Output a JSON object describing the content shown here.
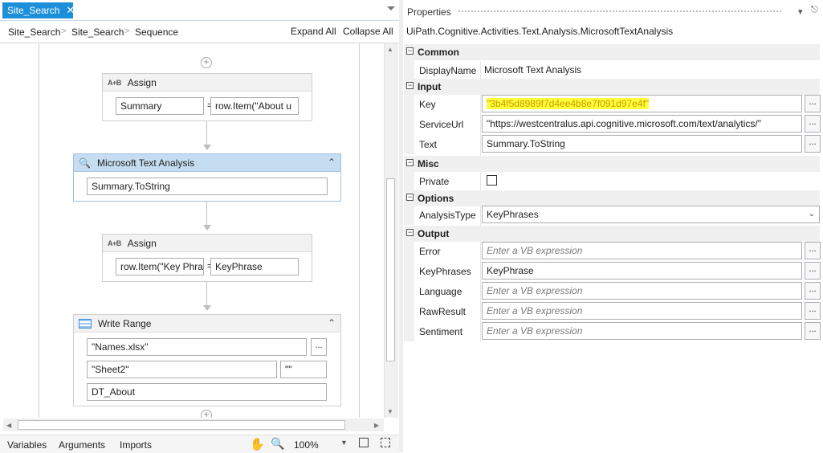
{
  "designer": {
    "tab_title": "Site_Search",
    "tab_close": "✕",
    "breadcrumb": [
      "Site_Search",
      "Site_Search",
      "Sequence"
    ],
    "expand_all": "Expand All",
    "collapse_all": "Collapse All",
    "activities": {
      "assign1": {
        "title": "Assign",
        "icon": "A+B",
        "to": "Summary",
        "value": "row.Item(\"About u"
      },
      "mta": {
        "title": "Microsoft Text Analysis",
        "text": "Summary.ToString"
      },
      "assign2": {
        "title": "Assign",
        "icon": "A+B",
        "to": "row.Item(\"Key Phra",
        "value": "KeyPhrase"
      },
      "write_range": {
        "title": "Write Range",
        "workbook": "\"Names.xlsx\"",
        "sheet": "\"Sheet2\"",
        "start_cell": "\"\"",
        "datatable": "DT_About"
      }
    },
    "bottom_tabs": [
      "Variables",
      "Arguments",
      "Imports"
    ],
    "zoom": "100%"
  },
  "properties": {
    "title": "Properties",
    "type_name": "UiPath.Cognitive.Activities.Text.Analysis.MicrosoftTextAnalysis",
    "categories": {
      "common": "Common",
      "input": "Input",
      "misc": "Misc",
      "options": "Options",
      "output": "Output"
    },
    "rows": {
      "display_name": {
        "label": "DisplayName",
        "value": "Microsoft Text Analysis"
      },
      "key": {
        "label": "Key",
        "value": "\"3b4f5d8989f7d4ee4b8e7f091d97e4f\""
      },
      "service_url": {
        "label": "ServiceUrl",
        "value": "\"https://westcentralus.api.cognitive.microsoft.com/text/analytics/\""
      },
      "text": {
        "label": "Text",
        "value": "Summary.ToString"
      },
      "private": {
        "label": "Private",
        "checked": false
      },
      "analysis_type": {
        "label": "AnalysisType",
        "value": "KeyPhrases"
      },
      "error": {
        "label": "Error",
        "placeholder": "Enter a VB expression"
      },
      "key_phrases": {
        "label": "KeyPhrases",
        "value": "KeyPhrase"
      },
      "language": {
        "label": "Language",
        "placeholder": "Enter a VB expression"
      },
      "raw_result": {
        "label": "RawResult",
        "placeholder": "Enter a VB expression"
      },
      "sentiment": {
        "label": "Sentiment",
        "placeholder": "Enter a VB expression"
      }
    },
    "dots": "..."
  },
  "colors": {
    "accent": "#1c8fdb",
    "selected_header": "#c6dcf0",
    "key_highlight": "#ffff3c"
  }
}
